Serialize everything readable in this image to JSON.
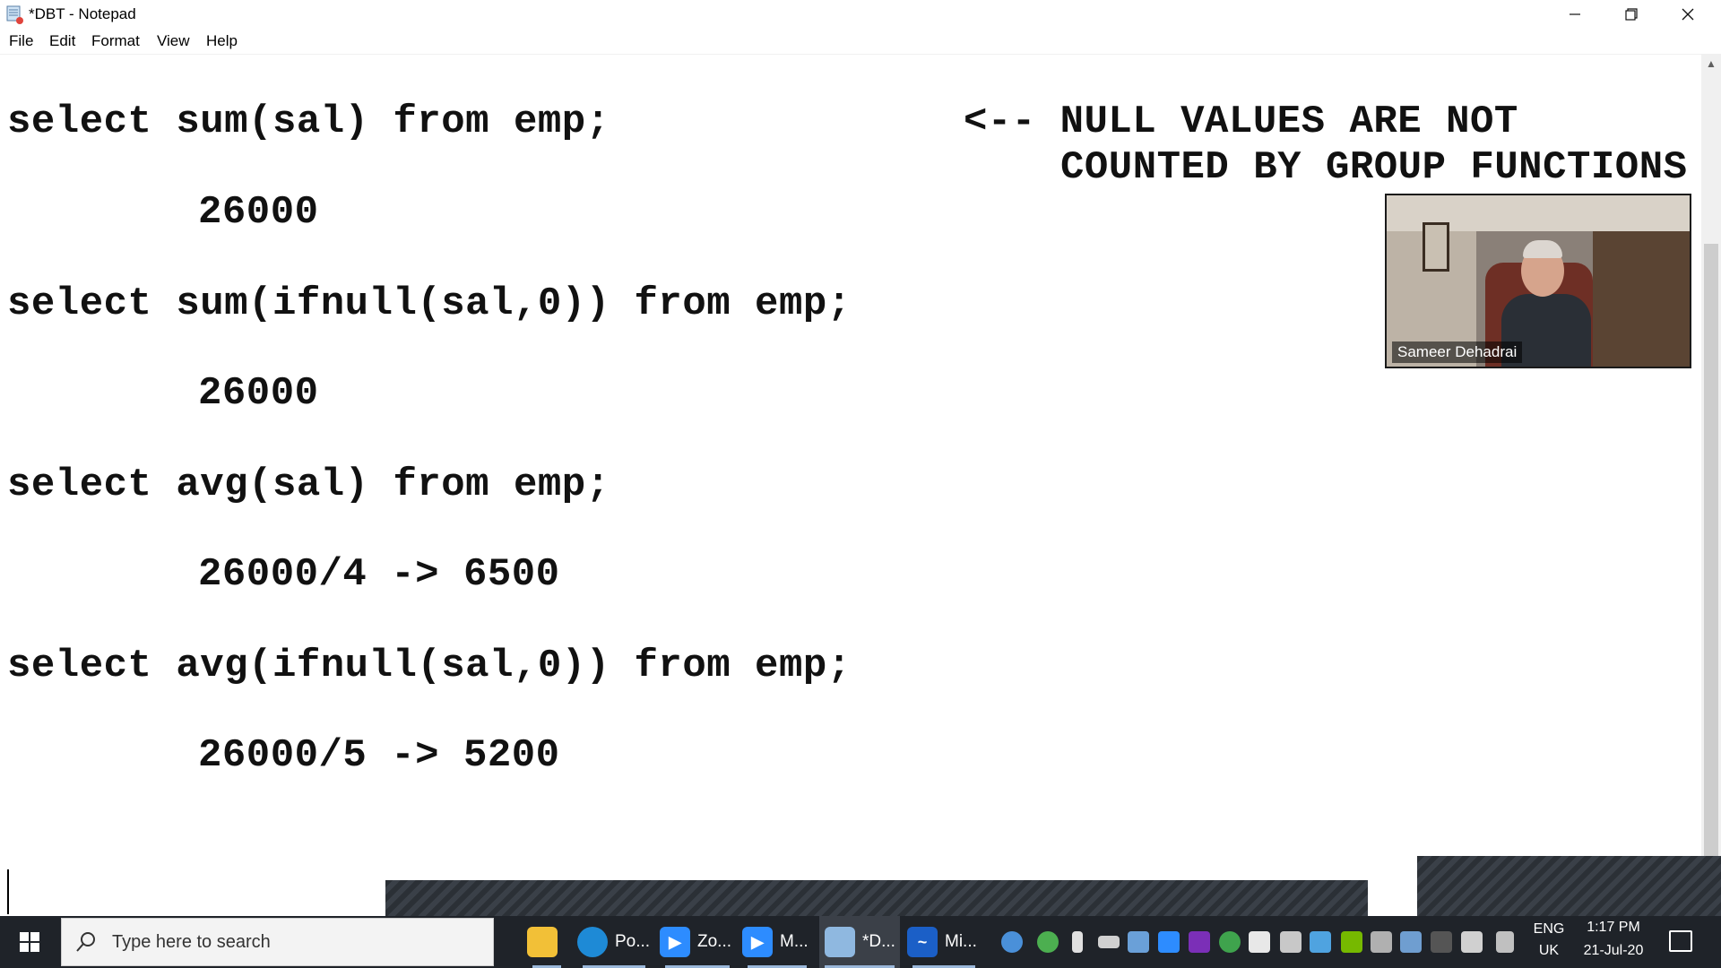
{
  "window": {
    "title": "*DBT - Notepad",
    "controls": {
      "minimize": "—",
      "maximize": "❐",
      "close": "✕"
    }
  },
  "menu": [
    "File",
    "Edit",
    "Format",
    "View",
    "Help"
  ],
  "editor": {
    "lines": [
      "select sum(sal) from emp;",
      "26000",
      "select sum(ifnull(sal,0)) from emp;",
      "26000",
      "select avg(sal) from emp;",
      "26000/4 -> 6500",
      "select avg(ifnull(sal,0)) from emp;",
      "26000/5 -> 5200"
    ],
    "note_line1": "<-- NULL VALUES ARE NOT",
    "note_line2": "COUNTED BY GROUP FUNCTIONS"
  },
  "webcam": {
    "participant_name": "Sameer Dehadrai"
  },
  "taskbar": {
    "search_placeholder": "Type here to search",
    "apps": [
      {
        "label": "",
        "icon": "file-explorer-icon",
        "color": "#f2c037"
      },
      {
        "label": "Po...",
        "icon": "edge-icon",
        "color": "#1e8ad6"
      },
      {
        "label": "Zo...",
        "icon": "zoom-icon",
        "color": "#2d8cff"
      },
      {
        "label": "M...",
        "icon": "zoom-meeting-icon",
        "color": "#2d8cff"
      },
      {
        "label": "*D...",
        "icon": "notepad-icon",
        "color": "#8fb8e0"
      },
      {
        "label": "Mi...",
        "icon": "whiteboard-icon",
        "color": "#1b5fc7"
      }
    ],
    "language_top": "ENG",
    "language_bottom": "UK",
    "time": "1:17 PM",
    "date": "21-Jul-20"
  }
}
